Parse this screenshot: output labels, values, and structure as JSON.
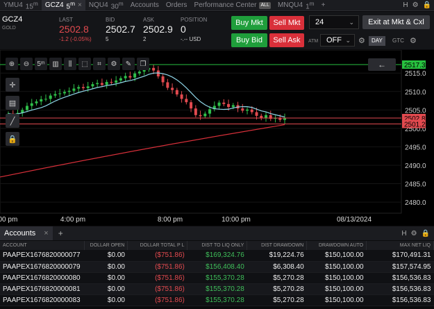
{
  "tabs": [
    {
      "sym": "YMU4",
      "tf": "15",
      "unit": "m",
      "active": false
    },
    {
      "sym": "GCZ4",
      "tf": "5",
      "unit": "m",
      "active": true
    },
    {
      "sym": "NQU4",
      "tf": "30",
      "unit": "m",
      "active": false
    }
  ],
  "tab_close": "×",
  "nav": {
    "accounts": "Accounts",
    "orders": "Orders",
    "performance": "Performance Center",
    "all_badge": "ALL"
  },
  "tab_extra": {
    "sym": "MNQU4",
    "tf": "1",
    "unit": "m"
  },
  "tab_add": "+",
  "tab_right": {
    "h": "H",
    "gear": "⚙",
    "lock": "🔒"
  },
  "quote": {
    "symbol": "GCZ4",
    "symbol_sub": "GOLD",
    "last_label": "LAST",
    "last": "2502.8",
    "change": "-1.2 (-0.05%)",
    "bid_label": "BID",
    "bid": "2502.7",
    "bid_size": "5",
    "ask_label": "ASK",
    "ask": "2502.9",
    "ask_size": "2",
    "position_label": "POSITION",
    "position": "0",
    "position_pnl": "-.-- USD"
  },
  "order": {
    "buy_mkt": "Buy Mkt",
    "sell_mkt": "Sell Mkt",
    "buy_bid": "Buy Bid",
    "sell_ask": "Sell Ask",
    "qty": "24",
    "exit": "Exit at Mkt & Cxl",
    "atm_label": "ATM",
    "tif": "OFF",
    "day": "DAY",
    "gtc": "GTC"
  },
  "chart_toolbar": {
    "zoom_in": "⊕",
    "zoom_out": "⊖",
    "timeframe": "5ᵐ",
    "candles": "▥",
    "bars": "⫼",
    "select": "⬚",
    "crosshair": "⌗",
    "settings": "⚙",
    "draw": "✎",
    "layers": "❐"
  },
  "side_toolbar": {
    "cross": "✛",
    "notes": "▤",
    "line": "╱",
    "lock": "🔒"
  },
  "back_arrow": "←",
  "chart_data": {
    "type": "candlestick",
    "x_ticks": [
      ":00 pm",
      "4:00 pm",
      "8:00 pm",
      "10:00 pm",
      "08/13/2024"
    ],
    "y_ticks": [
      2515.0,
      2510.0,
      2505.0,
      2500.0,
      2495.0,
      2490.0,
      2485.0,
      2480.0
    ],
    "ylim": [
      2477.0,
      2519.0
    ],
    "price_labels": [
      {
        "value": 2517.3,
        "color": "#27c23f"
      },
      {
        "value": 2502.8,
        "color": "#e24a4f"
      },
      {
        "value": 2501.2,
        "color": "#e24a4f"
      }
    ],
    "closes": [
      2504.0,
      2503.6,
      2504.2,
      2505.0,
      2506.1,
      2506.8,
      2507.3,
      2507.9,
      2508.0,
      2508.9,
      2509.3,
      2509.5,
      2509.9,
      2510.2,
      2510.8,
      2511.2,
      2510.9,
      2511.4,
      2512.0,
      2512.3,
      2511.8,
      2512.6,
      2512.4,
      2513.0,
      2513.6,
      2514.2,
      2513.8,
      2514.9,
      2515.4,
      2515.9,
      2516.4,
      2515.7,
      2514.1,
      2512.5,
      2511.0,
      2510.4,
      2509.2,
      2508.0,
      2507.1,
      2505.4,
      2503.6,
      2503.3,
      2504.0,
      2505.2,
      2506.1,
      2507.0,
      2506.6,
      2505.8,
      2506.3,
      2505.4,
      2504.8,
      2505.1,
      2504.4,
      2503.4,
      2502.8,
      2503.6,
      2502.6,
      2502.9,
      2502.3,
      2502.8
    ]
  },
  "accounts_panel": {
    "tab_label": "Accounts",
    "close": "×",
    "add": "+",
    "actions": {
      "h": "H",
      "gear": "⚙",
      "lock": "🔒"
    },
    "columns": [
      "ACCOUNT",
      "DOLLAR OPEN",
      "DOLLAR TOTAL P L",
      "DIST TO LIQ ONLY",
      "DIST DRAWDOWN",
      "DRAWDOWN AUTO",
      "MAX NET LIQ"
    ],
    "rows": [
      [
        "PAAPEX1676820000077",
        "$0.00",
        "($751.86)",
        "$169,324.76",
        "$19,224.76",
        "$150,100.00",
        "$170,491.31"
      ],
      [
        "PAAPEX1676820000079",
        "$0.00",
        "($751.86)",
        "$156,408.40",
        "$6,308.40",
        "$150,100.00",
        "$157,574.95"
      ],
      [
        "PAAPEX1676820000080",
        "$0.00",
        "($751.86)",
        "$155,370.28",
        "$5,270.28",
        "$150,100.00",
        "$156,536.83"
      ],
      [
        "PAAPEX1676820000081",
        "$0.00",
        "($751.86)",
        "$155,370.28",
        "$5,270.28",
        "$150,100.00",
        "$156,536.83"
      ],
      [
        "PAAPEX1676820000083",
        "$0.00",
        "($751.86)",
        "$155,370.28",
        "$5,270.28",
        "$150,100.00",
        "$156,536.83"
      ]
    ]
  }
}
